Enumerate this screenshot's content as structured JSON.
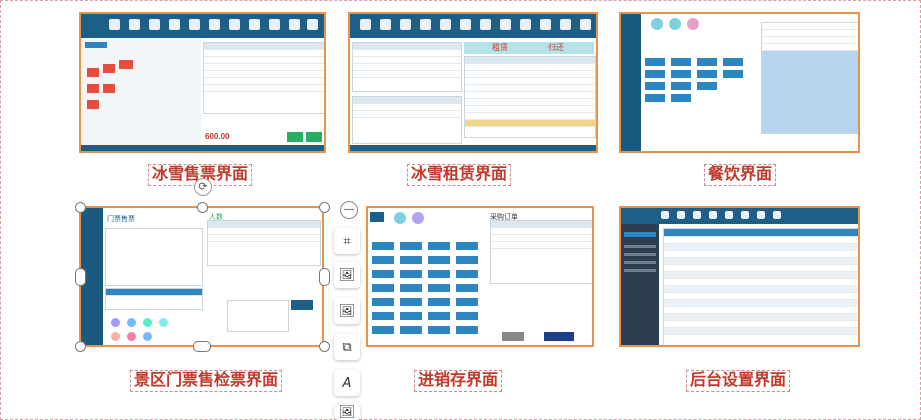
{
  "captions": {
    "ice_sale": "冰雪售票界面",
    "ice_rent": "冰雪租赁界面",
    "catering": "餐饮界面",
    "scenic": "景区门票售检票界面",
    "inventory": "进销存界面",
    "admin": "后台设置界面"
  },
  "thumbs": {
    "ice_sale_total": "600.00",
    "ice_rent_tab1": "租赁",
    "ice_rent_tab2": "归还",
    "scenic_title": "门票售票",
    "scenic_count": "人数",
    "inventory_title": "采购订单"
  },
  "toolbar": {
    "minus": "—",
    "crop": "⌗",
    "image_edit": "🖼",
    "image_replace": "🖼",
    "copy": "⧉",
    "font": "A",
    "more": "🖼"
  },
  "colors": {
    "accent": "#e8924a",
    "caption": "#c0392b",
    "app_header": "#1d5f86"
  }
}
